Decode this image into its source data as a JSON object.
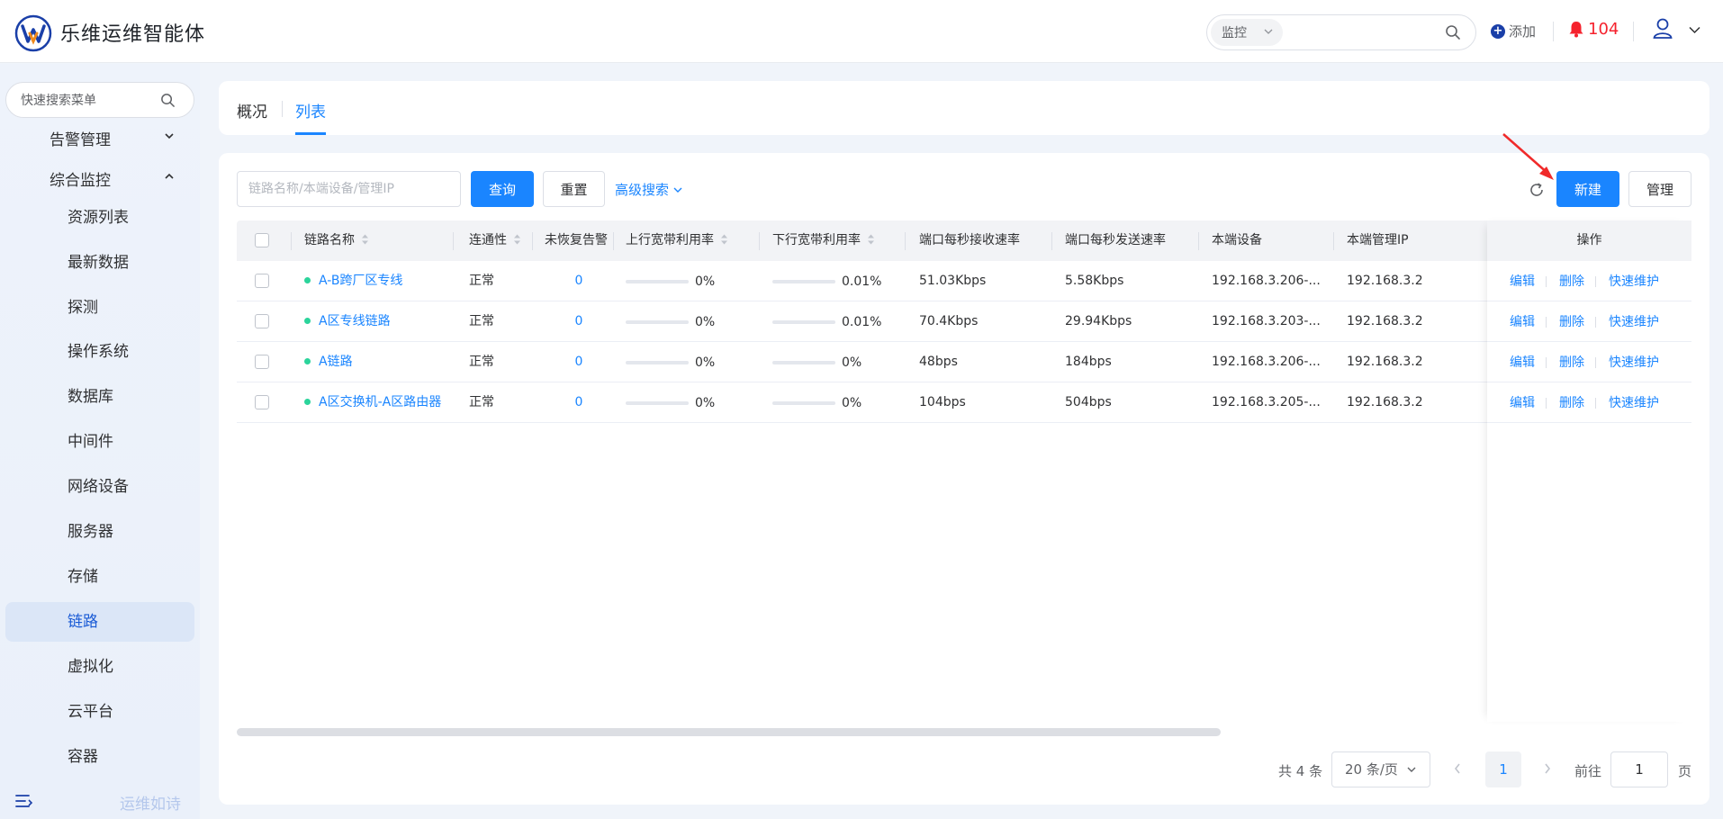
{
  "header": {
    "app_title": "乐维运维智能体",
    "search_scope": "监控",
    "add_label": "添加",
    "alarm_count": "104",
    "accent_color": "#1a85ff",
    "alarm_color": "#f5222d"
  },
  "sidebar": {
    "search_placeholder": "快速搜索菜单",
    "groups": [
      {
        "label": "告警管理",
        "expanded": false
      },
      {
        "label": "综合监控",
        "expanded": true
      }
    ],
    "items": [
      {
        "label": "资源列表",
        "active": false
      },
      {
        "label": "最新数据",
        "active": false
      },
      {
        "label": "探测",
        "active": false
      },
      {
        "label": "操作系统",
        "active": false
      },
      {
        "label": "数据库",
        "active": false
      },
      {
        "label": "中间件",
        "active": false
      },
      {
        "label": "网络设备",
        "active": false
      },
      {
        "label": "服务器",
        "active": false
      },
      {
        "label": "存储",
        "active": false
      },
      {
        "label": "链路",
        "active": true
      },
      {
        "label": "虚拟化",
        "active": false
      },
      {
        "label": "云平台",
        "active": false
      },
      {
        "label": "容器",
        "active": false
      }
    ],
    "footer_slogan": "运维如诗"
  },
  "tabs": [
    {
      "label": "概况",
      "active": false
    },
    {
      "label": "列表",
      "active": true
    }
  ],
  "toolbar": {
    "keyword_placeholder": "链路名称/本端设备/管理IP",
    "query_label": "查询",
    "reset_label": "重置",
    "advanced_label": "高级搜索",
    "new_label": "新建",
    "manage_label": "管理"
  },
  "table": {
    "columns": [
      "链路名称",
      "连通性",
      "未恢复告警",
      "上行宽带利用率",
      "下行宽带利用率",
      "端口每秒接收速率",
      "端口每秒发送速率",
      "本端设备",
      "本端管理IP",
      "操作"
    ],
    "rows": [
      {
        "name": "A-B跨厂区专线",
        "status": "正常",
        "alarms": "0",
        "up": "0%",
        "up_frac": 0,
        "down": "0.01%",
        "down_frac": 0.0001,
        "rx": "51.03Kbps",
        "tx": "5.58Kbps",
        "device": "192.168.3.206-...",
        "ip": "192.168.3.2"
      },
      {
        "name": "A区专线链路",
        "status": "正常",
        "alarms": "0",
        "up": "0%",
        "up_frac": 0,
        "down": "0.01%",
        "down_frac": 0.0001,
        "rx": "70.4Kbps",
        "tx": "29.94Kbps",
        "device": "192.168.3.203-...",
        "ip": "192.168.3.2"
      },
      {
        "name": "A链路",
        "status": "正常",
        "alarms": "0",
        "up": "0%",
        "up_frac": 0,
        "down": "0%",
        "down_frac": 0,
        "rx": "48bps",
        "tx": "184bps",
        "device": "192.168.3.206-...",
        "ip": "192.168.3.2"
      },
      {
        "name": "A区交换机-A区路由器",
        "status": "正常",
        "alarms": "0",
        "up": "0%",
        "up_frac": 0,
        "down": "0%",
        "down_frac": 0,
        "rx": "104bps",
        "tx": "504bps",
        "device": "192.168.3.205-...",
        "ip": "192.168.3.2"
      }
    ],
    "actions": [
      "编辑",
      "删除",
      "快速维护"
    ]
  },
  "pagination": {
    "total_label": "共 4 条",
    "page_size": "20 条/页",
    "current_page": "1",
    "goto_prefix": "前往",
    "goto_value": "1",
    "goto_suffix": "页"
  }
}
